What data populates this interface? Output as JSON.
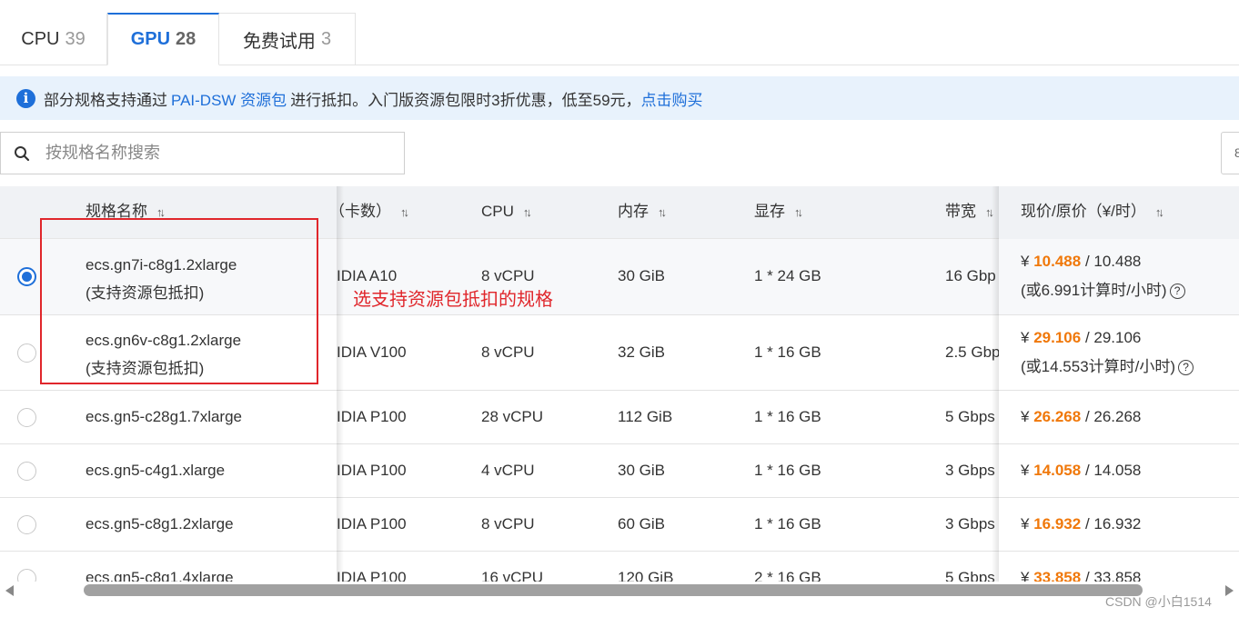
{
  "tabs": [
    {
      "label": "CPU",
      "count": "39"
    },
    {
      "label": "GPU",
      "count": "28"
    },
    {
      "label": "免费试用",
      "count": "3"
    }
  ],
  "notice": {
    "text_before": "部分规格支持通过",
    "link": "PAI-DSW 资源包",
    "text_after": "进行抵扣。入门版资源包限时3折优惠，低至59元，",
    "buy_link": "点击购买"
  },
  "search": {
    "placeholder": "按规格名称搜索",
    "value": ""
  },
  "right_select_value": "8",
  "columns": {
    "name": "规格名称",
    "gpu": "（卡数）",
    "cpu": "CPU",
    "memory": "内存",
    "vram": "显存",
    "bandwidth": "带宽",
    "price": "现价/原价（¥/时）"
  },
  "sort_glyph": "↑↓",
  "rows": [
    {
      "name": "ecs.gn7i-c8g1.2xlarge",
      "sub": "(支持资源包抵扣)",
      "gpu": "IDIA A10",
      "cpu": "8 vCPU",
      "memory": "30 GiB",
      "vram": "1 * 24 GB",
      "bandwidth": "16 Gbp",
      "currency": "¥",
      "price_now": "10.488",
      "price_orig": "/ 10.488",
      "price_note": "(或6.991计算时/小时)"
    },
    {
      "name": "ecs.gn6v-c8g1.2xlarge",
      "sub": "(支持资源包抵扣)",
      "gpu": "IDIA V100",
      "cpu": "8 vCPU",
      "memory": "32 GiB",
      "vram": "1 * 16 GB",
      "bandwidth": "2.5 Gbp",
      "currency": "¥",
      "price_now": "29.106",
      "price_orig": "/ 29.106",
      "price_note": "(或14.553计算时/小时)"
    },
    {
      "name": "ecs.gn5-c28g1.7xlarge",
      "gpu": "IDIA P100",
      "cpu": "28 vCPU",
      "memory": "112 GiB",
      "vram": "1 * 16 GB",
      "bandwidth": "5 Gbps",
      "currency": "¥",
      "price_now": "26.268",
      "price_orig": "/ 26.268"
    },
    {
      "name": "ecs.gn5-c4g1.xlarge",
      "gpu": "IDIA P100",
      "cpu": "4 vCPU",
      "memory": "30 GiB",
      "vram": "1 * 16 GB",
      "bandwidth": "3 Gbps",
      "currency": "¥",
      "price_now": "14.058",
      "price_orig": "/ 14.058"
    },
    {
      "name": "ecs.gn5-c8g1.2xlarge",
      "gpu": "IDIA P100",
      "cpu": "8 vCPU",
      "memory": "60 GiB",
      "vram": "1 * 16 GB",
      "bandwidth": "3 Gbps",
      "currency": "¥",
      "price_now": "16.932",
      "price_orig": "/ 16.932"
    },
    {
      "name": "ecs.gn5-c8g1.4xlarge",
      "gpu": "IDIA P100",
      "cpu": "16 vCPU",
      "memory": "120 GiB",
      "vram": "2 * 16 GB",
      "bandwidth": "5 Gbps",
      "currency": "¥",
      "price_now": "33.858",
      "price_orig": "/ 33.858"
    }
  ],
  "annotation": "选支持资源包抵扣的规格",
  "watermark": "CSDN @小白1514",
  "colors": {
    "accent": "#1e6fd9",
    "price": "#f0780a",
    "annotation": "#e0262b"
  }
}
